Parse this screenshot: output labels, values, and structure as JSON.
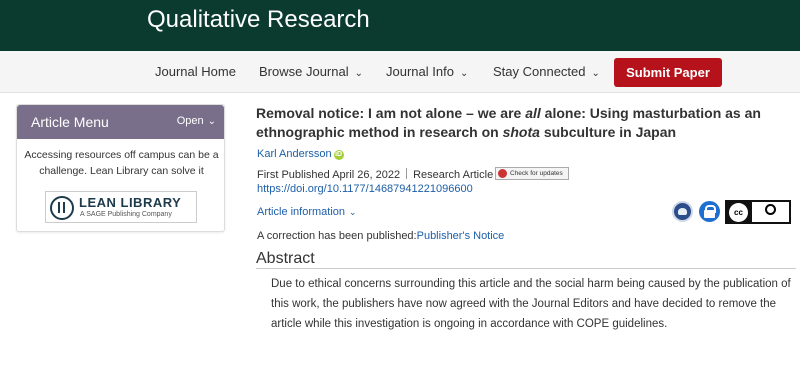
{
  "header": {
    "journal_title": "Qualitative Research"
  },
  "nav": {
    "items": [
      {
        "label": "Journal Home",
        "has_dropdown": false
      },
      {
        "label": "Browse Journal",
        "has_dropdown": true
      },
      {
        "label": "Journal Info",
        "has_dropdown": true
      },
      {
        "label": "Stay Connected",
        "has_dropdown": true
      }
    ],
    "submit_label": "Submit Paper"
  },
  "article_menu": {
    "title": "Article Menu",
    "open_label": "Open",
    "message": "Accessing resources off campus can be a challenge. Lean Library can solve it",
    "logo_name": "LEAN LIBRARY",
    "logo_sub": "A SAGE Publishing Company"
  },
  "article": {
    "title_parts": [
      {
        "text": "Removal notice: I am not alone – we are ",
        "italic": false
      },
      {
        "text": "all",
        "italic": true
      },
      {
        "text": " alone: Using masturbation as an ethnographic method in research on ",
        "italic": false
      },
      {
        "text": "shota",
        "italic": true
      },
      {
        "text": " subculture in Japan",
        "italic": false
      }
    ],
    "author": "Karl Andersson",
    "published": "First Published April 26, 2022",
    "type": "Research Article",
    "check_updates": "Check for updates",
    "doi": "https://doi.org/10.1177/14687941221096600",
    "info_label": "Article information",
    "correction_prefix": "A correction has been published:",
    "correction_link": "Publisher's Notice"
  },
  "abstract": {
    "heading": "Abstract",
    "text": "Due to ethical concerns surrounding this article and the social harm being caused by the publication of this work, the publishers have now agreed with the Journal Editors and have decided to remove the article while this investigation is ongoing in accordance with COPE guidelines."
  },
  "license": {
    "cc_label": "cc",
    "by_label": "BY"
  },
  "colors": {
    "banner": "#0b3b2e",
    "submit": "#b5121b",
    "menu_header": "#7a6f8a",
    "link": "#1d5fa8"
  }
}
